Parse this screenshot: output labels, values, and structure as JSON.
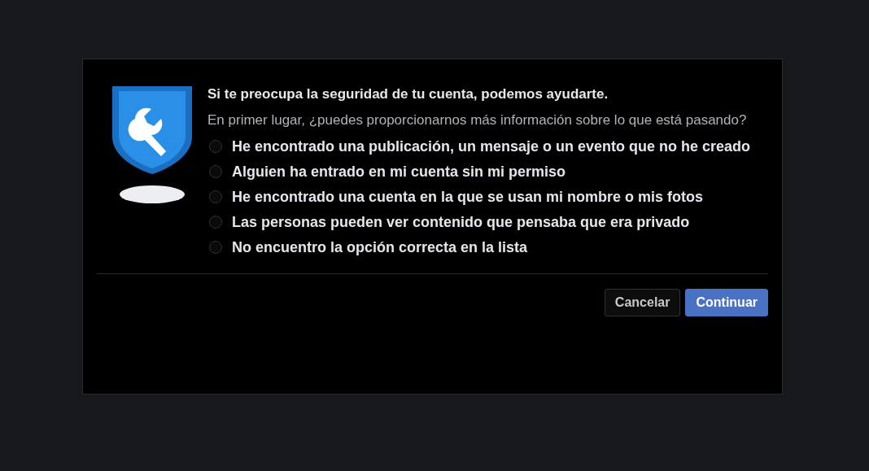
{
  "dialog": {
    "title": "Si te preocupa la seguridad de tu cuenta, podemos ayudarte.",
    "question": "En primer lugar, ¿puedes proporcionarnos más información sobre lo que está pasando?",
    "options": [
      {
        "label": "He encontrado una publicación, un mensaje o un evento que no he creado",
        "selected": false
      },
      {
        "label": "Alguien ha entrado en mi cuenta sin mi permiso",
        "selected": false
      },
      {
        "label": "He encontrado una cuenta en la que se usan mi nombre o mis fotos",
        "selected": false
      },
      {
        "label": "Las personas pueden ver contenido que pensaba que era privado",
        "selected": false
      },
      {
        "label": "No encuentro la opción correcta en la lista",
        "selected": false
      }
    ],
    "buttons": [
      {
        "label": "Cancelar",
        "kind": "secondary"
      },
      {
        "label": "Continuar",
        "kind": "primary"
      }
    ]
  }
}
